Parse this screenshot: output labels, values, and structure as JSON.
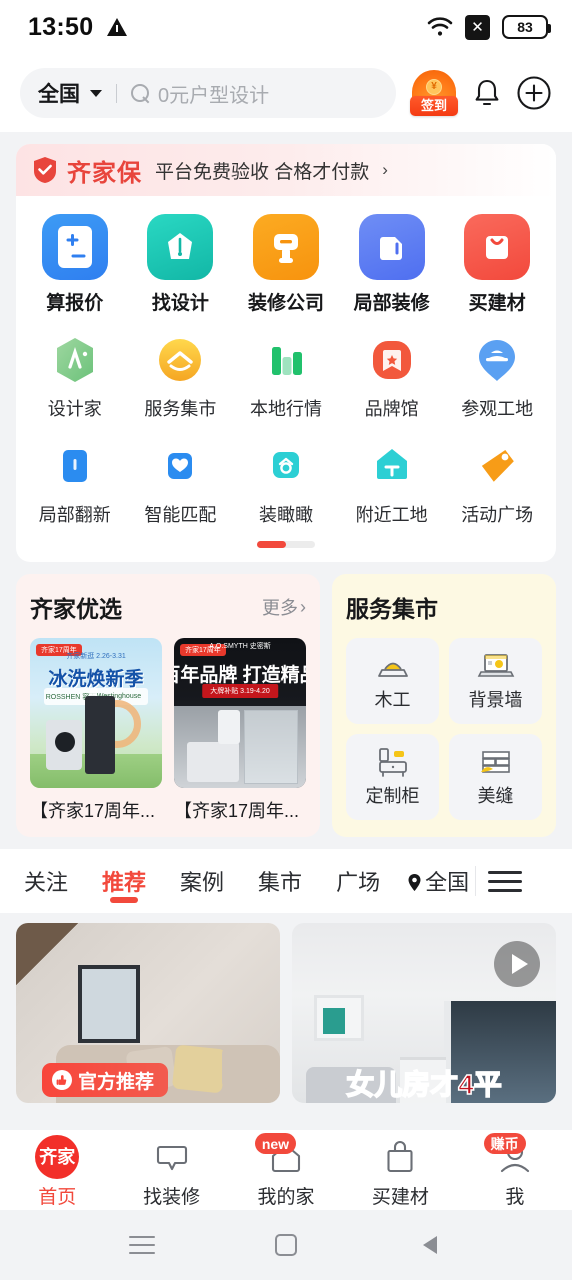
{
  "statusbar": {
    "time": "13:50",
    "battery": "83",
    "warning_icon": "warning-triangle-icon",
    "wifi_icon": "wifi-icon",
    "x_icon": "x-box-icon"
  },
  "header": {
    "city": "全国",
    "search_placeholder": "0元户型设计",
    "signin_label": "签到",
    "notification_icon": "bell-icon",
    "add_icon": "plus-circle-icon"
  },
  "qijiabao": {
    "brand": "齐家保",
    "text": "平台免费验收 合格才付款",
    "arrow": "›"
  },
  "grid": {
    "row1": [
      {
        "label": "算报价",
        "icon": "calculator-icon",
        "color": "#2b8cf0"
      },
      {
        "label": "找设计",
        "icon": "designer-crown-icon",
        "color": "#18c3ae"
      },
      {
        "label": "装修公司",
        "icon": "company-hammer-icon",
        "color": "#f79c17"
      },
      {
        "label": "局部装修",
        "icon": "partial-renovation-icon",
        "color": "#5b7bf0"
      },
      {
        "label": "买建材",
        "icon": "shopping-bag-icon",
        "color": "#f2493c"
      }
    ],
    "row2": [
      {
        "label": "设计家",
        "icon": "design-home-icon",
        "color": "#86d48a"
      },
      {
        "label": "服务集市",
        "icon": "service-market-icon",
        "color": "#fdc328"
      },
      {
        "label": "本地行情",
        "icon": "local-price-chart-icon",
        "color": "#22c36b"
      },
      {
        "label": "品牌馆",
        "icon": "brand-hall-icon",
        "color": "#f2583c"
      },
      {
        "label": "参观工地",
        "icon": "visit-site-helmet-icon",
        "color": "#5aa0f2"
      }
    ],
    "row3": [
      {
        "label": "局部翻新",
        "icon": "local-refresh-icon",
        "color": "#2b8cf0"
      },
      {
        "label": "智能匹配",
        "icon": "smart-match-heart-icon",
        "color": "#2b8cf0"
      },
      {
        "label": "装瞰瞰",
        "icon": "zhuangkankan-icon",
        "color": "#2ccfd4"
      },
      {
        "label": "附近工地",
        "icon": "nearby-site-house-icon",
        "color": "#2ccfd4"
      },
      {
        "label": "活动广场",
        "icon": "activity-tag-icon",
        "color": "#f79c17"
      }
    ]
  },
  "promo_left": {
    "title": "齐家优选",
    "more": "更多",
    "more_arrow": "›",
    "goods": [
      {
        "caption": "【齐家17周年...",
        "art": "art1",
        "badge": "齐家17周年",
        "subline": "齐家新逛 2.26-3.31",
        "headline": "冰洗焕新季",
        "brand_left": "ROSSHEN 容声",
        "brand_right": "Westinghouse"
      },
      {
        "caption": "【齐家17周年...",
        "art": "art2",
        "badge": "齐家17周年",
        "logo": "A.O.SMYTH 史密斯",
        "headline": "百年品牌 打造精品",
        "subline": "大牌补贴 3.19-4.20"
      }
    ]
  },
  "promo_right": {
    "title": "服务集市",
    "tiles": [
      {
        "label": "木工",
        "icon": "carpentry-icon"
      },
      {
        "label": "背景墙",
        "icon": "feature-wall-icon"
      },
      {
        "label": "定制柜",
        "icon": "custom-cabinet-icon"
      },
      {
        "label": "美缝",
        "icon": "tile-grouting-icon"
      }
    ]
  },
  "feed_tabs": {
    "items": [
      "关注",
      "推荐",
      "案例",
      "集市",
      "广场"
    ],
    "active_index": 1,
    "location": "全国",
    "location_icon": "map-pin-icon",
    "menu_icon": "hamburger-menu-icon"
  },
  "feed": {
    "cards": [
      {
        "badge": "官方推荐",
        "badge_icon": "official-thumb-icon",
        "title": ""
      },
      {
        "badge": "",
        "play_icon": "play-circle-icon",
        "title": "女儿房才4平"
      }
    ]
  },
  "bottom_nav": {
    "items": [
      {
        "label": "首页",
        "icon": "qijia-logo-icon",
        "logo_text": "齐家",
        "badge": "",
        "active": true
      },
      {
        "label": "找装修",
        "icon": "chat-bubble-icon",
        "badge": "",
        "active": false
      },
      {
        "label": "我的家",
        "icon": "home-icon",
        "badge": "new",
        "active": false
      },
      {
        "label": "买建材",
        "icon": "shopping-bag-icon",
        "badge": "",
        "active": false
      },
      {
        "label": "我",
        "icon": "profile-icon",
        "badge": "赚币",
        "active": false
      }
    ]
  },
  "android_nav": {
    "recents_icon": "recents-icon",
    "home_icon": "home-square-icon",
    "back_icon": "back-triangle-icon"
  },
  "colors": {
    "accent": "#f2493c",
    "bg": "#f2f3f5",
    "card": "#ffffff"
  }
}
